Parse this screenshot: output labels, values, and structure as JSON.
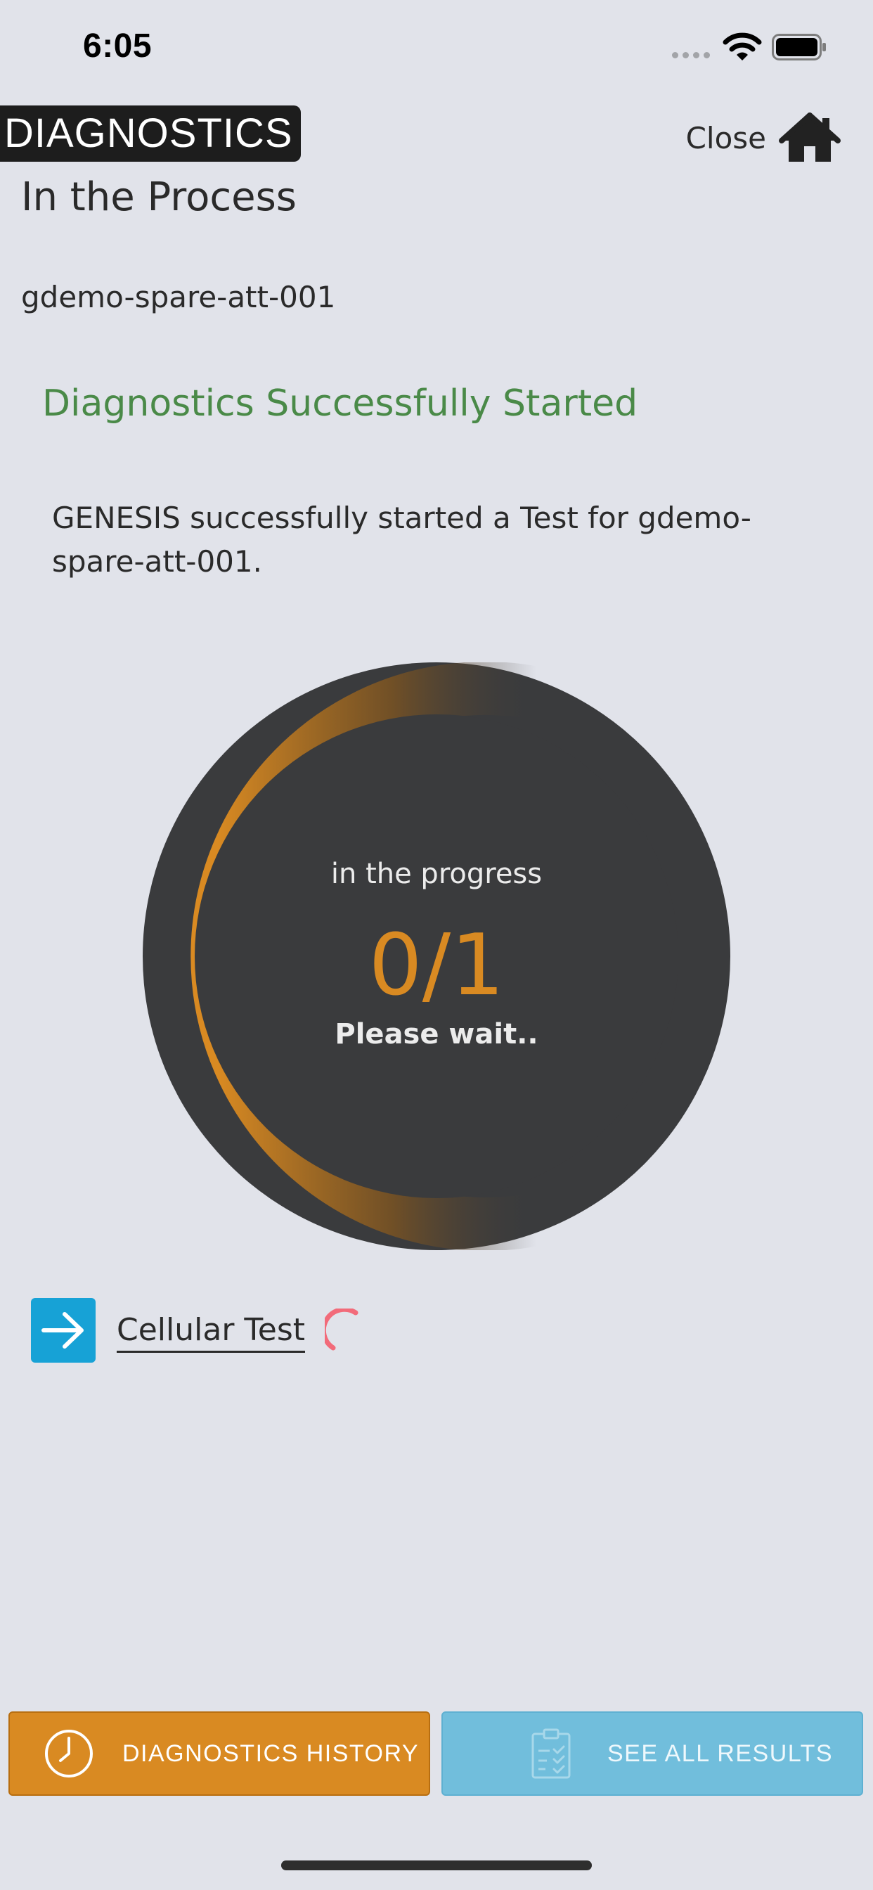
{
  "status_bar": {
    "time": "6:05"
  },
  "header": {
    "brand": "DIAGNOSTICS",
    "close_label": "Close"
  },
  "page": {
    "title": "In the Process",
    "device_name": "gdemo-spare-att-001",
    "success_title": "Diagnostics Successfully Started",
    "success_message": "GENESIS successfully started a Test for gdemo-spare-att-001."
  },
  "progress": {
    "caption": "in the progress",
    "count": "0/1",
    "wait_text": "Please wait..",
    "completed": 0,
    "total": 1
  },
  "test": {
    "label": "Cellular Test"
  },
  "buttons": {
    "history_label": "DIAGNOSTICS HISTORY",
    "results_label": "SEE ALL RESULTS"
  },
  "colors": {
    "accent_orange": "#d98a22",
    "accent_blue": "#17a2d6",
    "success_green": "#4a8a48",
    "ring_dark": "#3a3b3d",
    "spinner_red": "#f26b7a"
  }
}
